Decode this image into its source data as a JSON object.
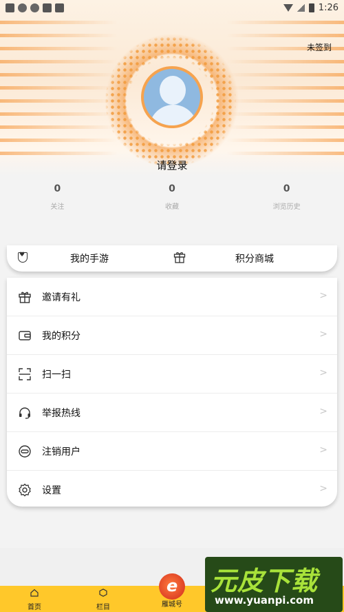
{
  "status_bar": {
    "time": "1:26"
  },
  "header": {
    "checkin_label": "未签到",
    "login_label": "请登录"
  },
  "stats": [
    {
      "value": "0",
      "label": "关注"
    },
    {
      "value": "0",
      "label": "收藏"
    },
    {
      "value": "0",
      "label": "浏览历史"
    }
  ],
  "quickbar": {
    "games_label": "我的手游",
    "mall_label": "积分商城"
  },
  "menu": [
    {
      "label": "邀请有礼",
      "icon": "gift-icon"
    },
    {
      "label": "我的积分",
      "icon": "wallet-icon"
    },
    {
      "label": "扫一扫",
      "icon": "scan-icon"
    },
    {
      "label": "举报热线",
      "icon": "headset-icon"
    },
    {
      "label": "注销用户",
      "icon": "link-icon"
    },
    {
      "label": "设置",
      "icon": "gear-icon"
    }
  ],
  "tabbar": [
    {
      "label": "首页",
      "icon": "home-icon"
    },
    {
      "label": "栏目",
      "icon": "hexagon-icon"
    },
    {
      "label": "雁城号",
      "icon": "brand-logo-icon"
    },
    {
      "label": "",
      "icon": ""
    },
    {
      "label": "",
      "icon": ""
    }
  ],
  "watermark": {
    "title": "元皮下载",
    "url": "www.yuanpi.com"
  },
  "colors": {
    "accent": "#f29b3c",
    "tabbar": "#ffc82a",
    "avatar": "#8fb9e0"
  }
}
